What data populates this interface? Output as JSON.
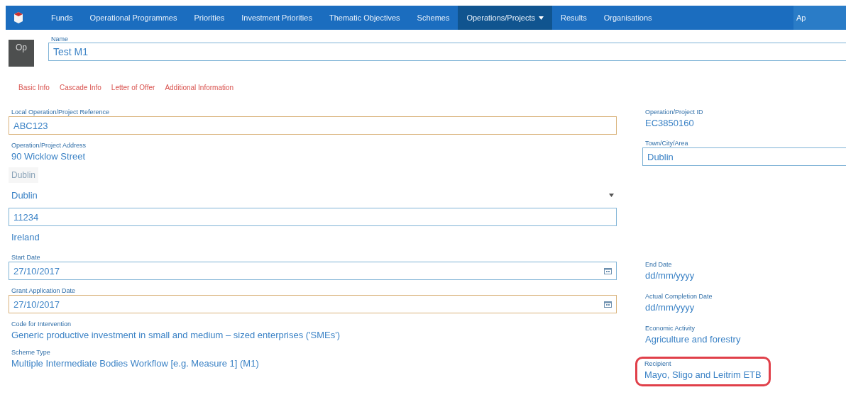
{
  "nav": {
    "items": [
      {
        "label": "Funds",
        "selected": false
      },
      {
        "label": "Operational Programmes",
        "selected": false
      },
      {
        "label": "Priorities",
        "selected": false
      },
      {
        "label": "Investment Priorities",
        "selected": false
      },
      {
        "label": "Thematic Objectives",
        "selected": false
      },
      {
        "label": "Schemes",
        "selected": false
      },
      {
        "label": "Operations/Projects",
        "selected": true
      },
      {
        "label": "Results",
        "selected": false
      },
      {
        "label": "Organisations",
        "selected": false
      }
    ],
    "overflow_label": "Ap"
  },
  "record": {
    "avatar_text": "Op",
    "name_label": "Name",
    "name_value": "Test M1"
  },
  "tabs": [
    {
      "label": "Basic Info",
      "selected": false
    },
    {
      "label": "Cascade Info",
      "selected": false
    },
    {
      "label": "Letter of Offer",
      "selected": false
    },
    {
      "label": "Additional Information",
      "selected": false
    }
  ],
  "sections": [
    {
      "left": [
        {
          "kind": "input",
          "label": "Local Operation/Project Reference",
          "value": "ABC123",
          "highlighted": true
        },
        {
          "kind": "address",
          "label": "Operation/Project Address",
          "lines": [
            {
              "kind": "text",
              "value": "90 Wicklow Street"
            },
            {
              "kind": "muted",
              "value": "Dublin"
            },
            {
              "kind": "select",
              "value": "Dublin"
            },
            {
              "kind": "input",
              "value": "11234"
            },
            {
              "kind": "text",
              "value": "Ireland"
            }
          ]
        }
      ],
      "right": [
        {
          "kind": "text",
          "label": "Operation/Project ID",
          "value": "EC3850160"
        },
        {
          "kind": "input",
          "label": "Town/City/Area",
          "value": "Dublin",
          "highlighted": false
        }
      ]
    },
    {
      "left": [
        {
          "kind": "date",
          "label": "Start Date",
          "value": "27/10/2017",
          "highlighted": false
        },
        {
          "kind": "date",
          "label": "Grant Application Date",
          "value": "27/10/2017",
          "highlighted": true
        },
        {
          "kind": "text",
          "label": "Code for Intervention",
          "value": "Generic productive investment in small and medium – sized enterprises ('SMEs')"
        },
        {
          "kind": "text",
          "label": "Scheme Type",
          "value": "Multiple Intermediate Bodies Workflow [e.g. Measure 1] (M1)"
        }
      ],
      "right": [
        {
          "kind": "placeholder",
          "label": "End Date",
          "placeholder": "dd/mm/yyyy"
        },
        {
          "kind": "placeholder",
          "label": "Actual Completion Date",
          "placeholder": "dd/mm/yyyy"
        },
        {
          "kind": "text",
          "label": "Economic Activity",
          "value": "Agriculture and forestry"
        },
        {
          "kind": "text",
          "label": "Recipient",
          "value": "Mayo, Sligo and Leitrim ETB",
          "circled": true
        }
      ]
    }
  ]
}
